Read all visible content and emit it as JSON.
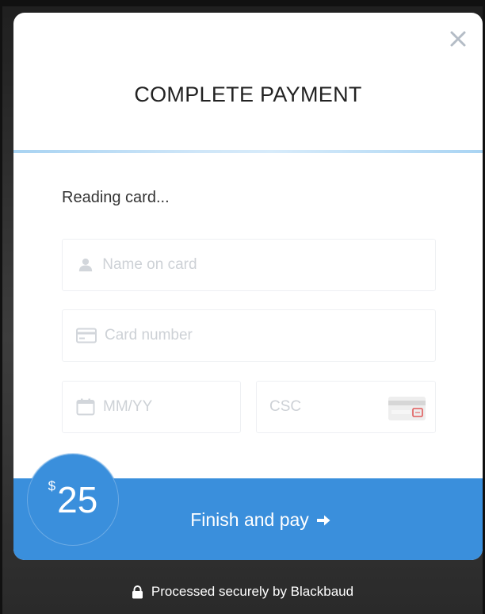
{
  "modal": {
    "title": "COMPLETE PAYMENT",
    "status": "Reading card...",
    "close_icon": "close-icon"
  },
  "form": {
    "name": {
      "placeholder": "Name on card",
      "icon": "user-icon"
    },
    "card_number": {
      "placeholder": "Card number",
      "icon": "credit-card-icon"
    },
    "expiry": {
      "placeholder": "MM/YY",
      "icon": "calendar-icon"
    },
    "csc": {
      "placeholder": "CSC",
      "icon": "card-back-icon"
    }
  },
  "payment": {
    "currency": "$",
    "amount": "25",
    "button_label": "Finish and pay",
    "button_icon": "arrow-right-icon"
  },
  "footer": {
    "text": "Processed securely by Blackbaud",
    "icon": "lock-icon"
  },
  "colors": {
    "accent": "#3a8fdc",
    "progress": "#a8d3f2",
    "placeholder": "#cdd1d6"
  }
}
